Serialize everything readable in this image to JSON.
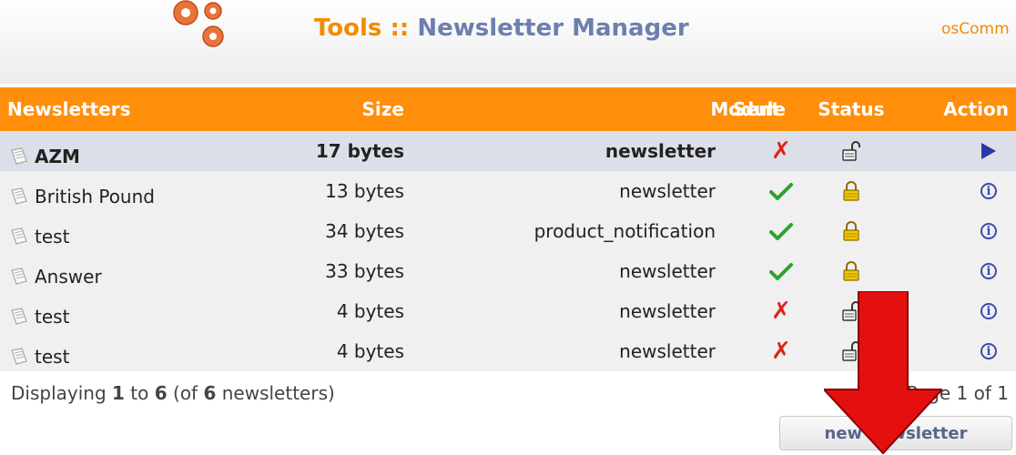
{
  "header": {
    "title_prefix": "Tools ::",
    "title_main": "Newsletter Manager",
    "brand": "osComm",
    "gears_icon": "gears-icon"
  },
  "table": {
    "columns": {
      "name": "Newsletters",
      "size": "Size",
      "module": "Module",
      "sent": "Sent",
      "status": "Status",
      "action": "Action"
    },
    "rows": [
      {
        "name": "AZM",
        "size": "17 bytes",
        "module": "newsletter",
        "sent": "no",
        "status": "unlocked",
        "action": "selected-arrow"
      },
      {
        "name": "British Pound",
        "size": "13 bytes",
        "module": "newsletter",
        "sent": "yes",
        "status": "locked",
        "action": "info"
      },
      {
        "name": "test",
        "size": "34 bytes",
        "module": "product_notification",
        "sent": "yes",
        "status": "locked",
        "action": "info"
      },
      {
        "name": "Answer",
        "size": "33 bytes",
        "module": "newsletter",
        "sent": "yes",
        "status": "locked",
        "action": "info"
      },
      {
        "name": "test",
        "size": "4 bytes",
        "module": "newsletter",
        "sent": "no",
        "status": "unlocked",
        "action": "info"
      },
      {
        "name": "test",
        "size": "4 bytes",
        "module": "newsletter",
        "sent": "no",
        "status": "unlocked",
        "action": "info"
      }
    ]
  },
  "footer": {
    "displaying_prefix": "Displaying ",
    "from": "1",
    "to_word": " to ",
    "to": "6",
    "of_prefix": " (of ",
    "total": "6",
    "of_suffix": " newsletters)",
    "pager_text": "Page 1 of 1"
  },
  "buttons": {
    "new_newsletter": "new newsletter"
  },
  "colors": {
    "header_orange": "#ff8e0b",
    "title_orange": "#f28c00",
    "title_blue": "#6c7fb0",
    "annotation_arrow": "#e41010"
  }
}
